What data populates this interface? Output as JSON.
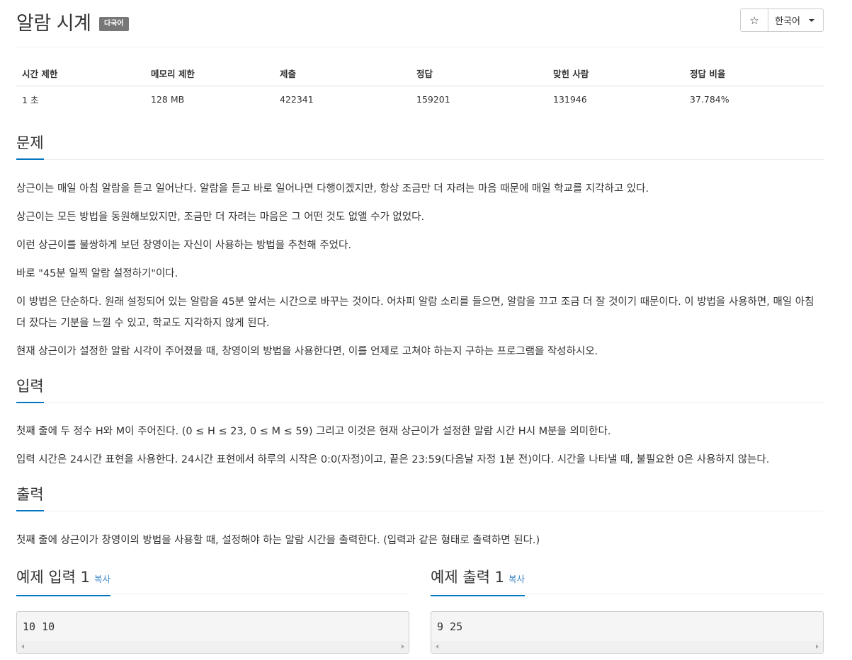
{
  "problem": {
    "title": "알람 시계",
    "language_badge": "다국어"
  },
  "toolbar": {
    "star_icon": "star-icon",
    "language_label": "한국어"
  },
  "info": {
    "headers": [
      "시간 제한",
      "메모리 제한",
      "제출",
      "정답",
      "맞힌 사람",
      "정답 비율"
    ],
    "values": [
      "1 초",
      "128 MB",
      "422341",
      "159201",
      "131946",
      "37.784%"
    ]
  },
  "description": {
    "heading": "문제",
    "paragraphs": [
      "상근이는 매일 아침 알람을 듣고 일어난다. 알람을 듣고 바로 일어나면 다행이겠지만, 항상 조금만 더 자려는 마음 때문에 매일 학교를 지각하고 있다.",
      "상근이는 모든 방법을 동원해보았지만, 조금만 더 자려는 마음은 그 어떤 것도 없앨 수가 없었다.",
      "이런 상근이를 불쌍하게 보던 창영이는 자신이 사용하는 방법을 추천해 주었다.",
      "바로 \"45분 일찍 알람 설정하기\"이다.",
      "이 방법은 단순하다. 원래 설정되어 있는 알람을 45분 앞서는 시간으로 바꾸는 것이다. 어차피 알람 소리를 들으면, 알람을 끄고 조금 더 잘 것이기 때문이다. 이 방법을 사용하면, 매일 아침 더 잤다는 기분을 느낄 수 있고, 학교도 지각하지 않게 된다.",
      "현재 상근이가 설정한 알람 시각이 주어졌을 때, 창영이의 방법을 사용한다면, 이를 언제로 고쳐야 하는지 구하는 프로그램을 작성하시오."
    ]
  },
  "input": {
    "heading": "입력",
    "paragraphs": [
      "첫째 줄에 두 정수 H와 M이 주어진다. (0 ≤ H ≤ 23, 0 ≤ M ≤ 59) 그리고 이것은 현재 상근이가 설정한 알람 시간 H시 M분을 의미한다.",
      "입력 시간은 24시간 표현을 사용한다. 24시간 표현에서 하루의 시작은 0:0(자정)이고, 끝은 23:59(다음날 자정 1분 전)이다. 시간을 나타낼 때, 불필요한 0은 사용하지 않는다."
    ]
  },
  "output": {
    "heading": "출력",
    "paragraphs": [
      "첫째 줄에 상근이가 창영이의 방법을 사용할 때, 설정해야 하는 알람 시간을 출력한다. (입력과 같은 형태로 출력하면 된다.)"
    ]
  },
  "samples": {
    "input_heading": "예제 입력 1",
    "output_heading": "예제 출력 1",
    "copy_label": "복사",
    "input_value": "10 10",
    "output_value": "9 25"
  }
}
